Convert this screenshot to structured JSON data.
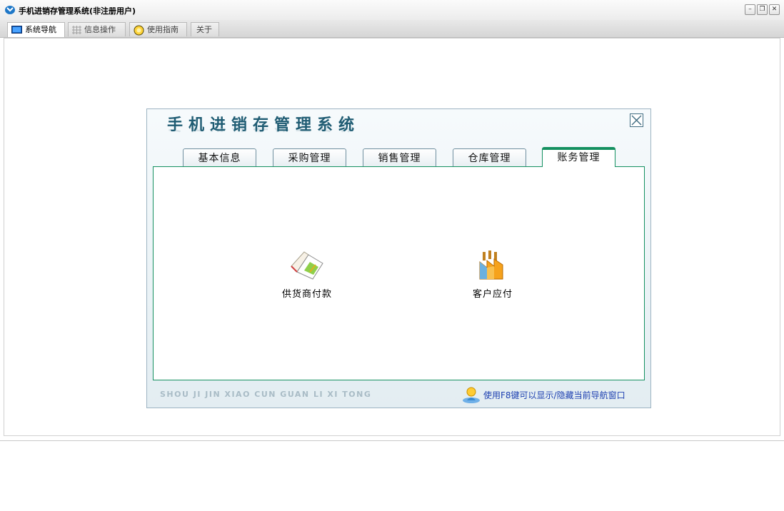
{
  "window": {
    "title": "手机进销存管理系统(非注册用户)",
    "controls": {
      "minimize": "–",
      "restore": "❐",
      "close": "✕"
    }
  },
  "main_tabs": [
    {
      "label": "系统导航",
      "icon": "monitor-icon",
      "active": true
    },
    {
      "label": "信息操作",
      "icon": "grid-icon",
      "active": false
    },
    {
      "label": "使用指南",
      "icon": "lightbulb-icon",
      "active": false
    },
    {
      "label": "关于",
      "icon": "",
      "active": false
    }
  ],
  "nav_panel": {
    "title": "手机进销存管理系统",
    "tabs": [
      "基本信息",
      "采购管理",
      "销售管理",
      "仓库管理",
      "账务管理"
    ],
    "active_tab": "账务管理",
    "items": [
      {
        "label": "供货商付款",
        "icon": "notebook-icon"
      },
      {
        "label": "客户应付",
        "icon": "factory-icon"
      }
    ],
    "footer_pinyin": "SHOU JI JIN XIAO CUN GUAN LI XI TONG",
    "footer_hint": "使用F8键可以显示/隐藏当前导航窗口"
  },
  "colors": {
    "accent_green": "#149060",
    "title_blue": "#1f5c73",
    "hint_blue": "#1c3fb0"
  }
}
